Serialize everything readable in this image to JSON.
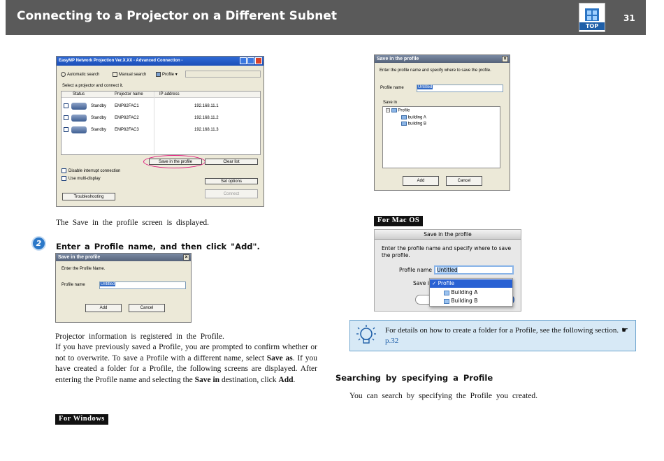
{
  "header": {
    "title": "Connecting to a Projector on a Different Subnet",
    "top_label": "TOP",
    "page_number": "31"
  },
  "main_dialog": {
    "title": "EasyMP Network Projection Ver.X.XX - Advanced Connection -",
    "toolbar": {
      "auto": "Automatic search",
      "manual": "Manual search",
      "profile": "Profile"
    },
    "instruction": "Select a projector and connect it.",
    "columns": [
      "Status",
      "Projector name",
      "IP address"
    ],
    "rows": [
      {
        "status": "Standby",
        "name": "EMP82FAC1",
        "ip": "192.168.11.1"
      },
      {
        "status": "Standby",
        "name": "EMP82FAC2",
        "ip": "192.168.11.2"
      },
      {
        "status": "Standby",
        "name": "EMP82FAC3",
        "ip": "192.168.11.3"
      }
    ],
    "save_profile": "Save in the profile",
    "clear_list": "Clear list",
    "disable_interrupt": "Disable interrupt connection",
    "multi_display": "Use multi-display",
    "set_options": "Set options",
    "troubleshooting": "Troubleshooting",
    "connect": "Connect"
  },
  "text_save_displayed": "The Save in the profile screen is displayed.",
  "step2": {
    "number": "2",
    "heading": "Enter a Profile name, and then click \"Add\"."
  },
  "small_dialog": {
    "title": "Save in the profile",
    "prompt": "Enter the Profile Name.",
    "label": "Profile name",
    "value": "Untitled",
    "add": "Add",
    "cancel": "Cancel"
  },
  "para1": "Projector information is registered in the Profile.",
  "para2_parts": {
    "a": "If you have previously saved a Profile, you are prompted to confirm whether or not to overwrite. To save a Profile with a different name, select ",
    "save_as": "Save as",
    "b": ". If you have created a folder for a Profile, the following screens are displayed. After entering the Profile name and selecting the ",
    "save_in": "Save in",
    "c": " destination, click ",
    "add": "Add",
    "d": "."
  },
  "tag_windows": "For Windows",
  "tag_mac": "For Mac OS",
  "right_dialog": {
    "title": "Save in the profile",
    "prompt": "Enter the profile name and specify where to save the profile.",
    "label": "Profile name",
    "value": "Untitled",
    "save_in": "Save in",
    "tree": [
      "Profile",
      "building A",
      "building B"
    ],
    "add": "Add",
    "cancel": "Cancel"
  },
  "mac_dialog": {
    "title": "Save in the profile",
    "prompt_line1": "Enter the profile name and specify where to save",
    "prompt_line2": "the profile.",
    "label": "Profile name",
    "value": "Untitled",
    "save_in": "Save i",
    "menu": [
      "✓ Profile",
      "Building A",
      "Building B"
    ]
  },
  "note": {
    "text": "For details on how to create a folder for a Profile, see the following section.",
    "link_icon": "☛",
    "link": "p.32"
  },
  "section_heading": "Searching by specifying a Profile",
  "section_text": "You can search by specifying the Profile you created."
}
